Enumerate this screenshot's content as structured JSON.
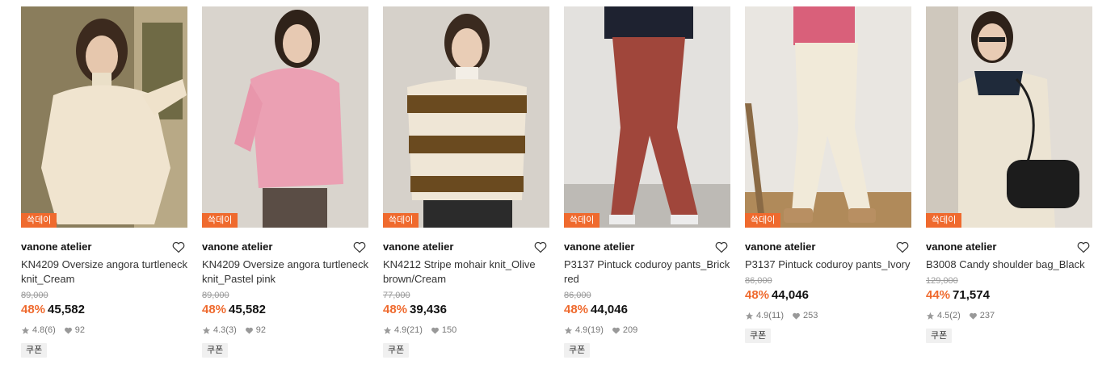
{
  "colors": {
    "accent": "#ef6a2e",
    "muted": "#999999"
  },
  "products": [
    {
      "badge": "쓱데이",
      "brand": "vanone atelier",
      "name": "KN4209 Oversize angora turtleneck knit_Cream",
      "original_price": "89,000",
      "discount": "48%",
      "price": "45,582",
      "rating": "4.8",
      "reviews": "(6)",
      "likes": "92",
      "coupon": "쿠폰",
      "icon": "heart-outline-icon"
    },
    {
      "badge": "쓱데이",
      "brand": "vanone atelier",
      "name": "KN4209 Oversize angora turtleneck knit_Pastel pink",
      "original_price": "89,000",
      "discount": "48%",
      "price": "45,582",
      "rating": "4.3",
      "reviews": "(3)",
      "likes": "92",
      "coupon": "쿠폰",
      "icon": "heart-outline-icon"
    },
    {
      "badge": "쓱데이",
      "brand": "vanone atelier",
      "name": "KN4212 Stripe mohair knit_Olive brown/Cream",
      "original_price": "77,000",
      "discount": "48%",
      "price": "39,436",
      "rating": "4.9",
      "reviews": "(21)",
      "likes": "150",
      "coupon": "쿠폰",
      "icon": "heart-outline-icon"
    },
    {
      "badge": "쓱데이",
      "brand": "vanone atelier",
      "name": "P3137 Pintuck coduroy pants_Brick red",
      "original_price": "86,000",
      "discount": "48%",
      "price": "44,046",
      "rating": "4.9",
      "reviews": "(19)",
      "likes": "209",
      "coupon": "쿠폰",
      "icon": "heart-outline-icon"
    },
    {
      "badge": "쓱데이",
      "brand": "vanone atelier",
      "name": "P3137 Pintuck coduroy pants_Ivory",
      "original_price": "86,000",
      "discount": "48%",
      "price": "44,046",
      "rating": "4.9",
      "reviews": "(11)",
      "likes": "253",
      "coupon": "쿠폰",
      "icon": "heart-outline-icon"
    },
    {
      "badge": "쓱데이",
      "brand": "vanone atelier",
      "name": "B3008 Candy shoulder bag_Black",
      "original_price": "129,000",
      "discount": "44%",
      "price": "71,574",
      "rating": "4.5",
      "reviews": "(2)",
      "likes": "237",
      "coupon": "쿠폰",
      "icon": "heart-outline-icon"
    }
  ]
}
